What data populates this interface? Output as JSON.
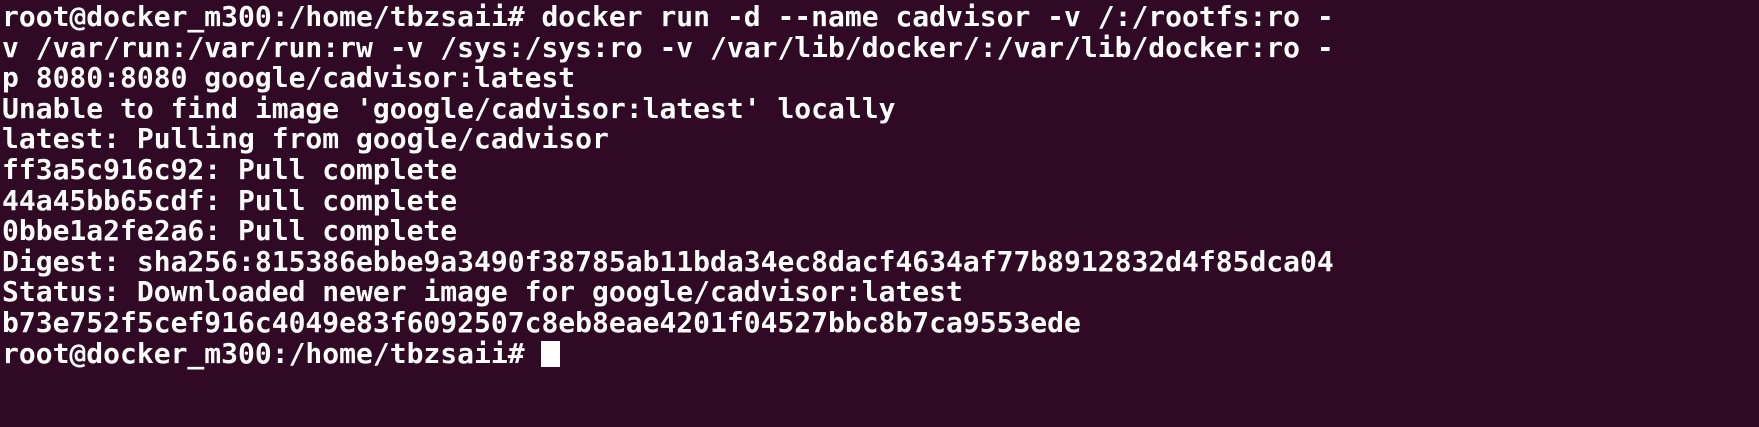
{
  "terminal": {
    "lines": [
      "root@docker_m300:/home/tbzsaii# docker run -d --name cadvisor -v /:/rootfs:ro -",
      "v /var/run:/var/run:rw -v /sys:/sys:ro -v /var/lib/docker/:/var/lib/docker:ro -",
      "p 8080:8080 google/cadvisor:latest",
      "Unable to find image 'google/cadvisor:latest' locally",
      "latest: Pulling from google/cadvisor",
      "ff3a5c916c92: Pull complete",
      "44a45bb65cdf: Pull complete",
      "0bbe1a2fe2a6: Pull complete",
      "Digest: sha256:815386ebbe9a3490f38785ab11bda34ec8dacf4634af77b8912832d4f85dca04",
      "Status: Downloaded newer image for google/cadvisor:latest",
      "b73e752f5cef916c4049e83f6092507c8eb8eae4201f04527bbc8b7ca9553ede"
    ],
    "prompt": "root@docker_m300:/home/tbzsaii# ",
    "colors": {
      "background": "#300a24",
      "foreground": "#ffffff"
    }
  }
}
